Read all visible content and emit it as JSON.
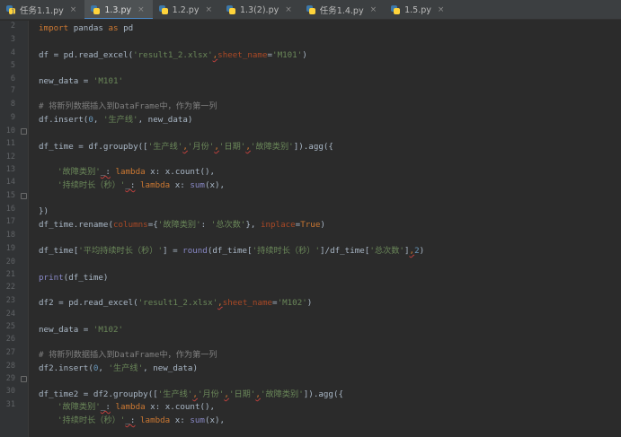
{
  "tabs": [
    {
      "label": "任务1.1.py",
      "active": false
    },
    {
      "label": "1.3.py",
      "active": true
    },
    {
      "label": "1.2.py",
      "active": false
    },
    {
      "label": "1.3(2).py",
      "active": false
    },
    {
      "label": "任务1.4.py",
      "active": false
    },
    {
      "label": "1.5.py",
      "active": false
    }
  ],
  "line_numbers": [
    "1",
    "2",
    "3",
    "4",
    "5",
    "6",
    "7",
    "8",
    "9",
    "10",
    "11",
    "12",
    "13",
    "14",
    "15",
    "16",
    "17",
    "18",
    "19",
    "20",
    "21",
    "22",
    "23",
    "24",
    "25",
    "26",
    "27",
    "28",
    "29",
    "30",
    "31"
  ],
  "code": {
    "l1_import": "import",
    "l1_mod": " pandas ",
    "l1_as": "as",
    "l1_alias": " pd",
    "l3_a": "df = pd.read_excel(",
    "l3_file": "'result1_2.xlsx'",
    "l3_comma": ",",
    "l3_kw": "sheet_name",
    "l3_eq": "=",
    "l3_sheet": "'M101'",
    "l3_close": ")",
    "l5_a": "new_data = ",
    "l5_val": "'M101'",
    "l7_cmt": "# 将新列数据插入到DataFrame中，作为第一列",
    "l8_a": "df.insert(",
    "l8_num": "0",
    "l8_b": ", ",
    "l8_str": "'生产线'",
    "l8_c": ", new_data)",
    "l10_a": "df_time = df.groupby([",
    "l10_s1": "'生产线'",
    "l10_c1": ",",
    "l10_s2": "'月份'",
    "l10_c2": ",",
    "l10_s3": "'日期'",
    "l10_c3": ",",
    "l10_s4": "'故障类别'",
    "l10_b": "]).agg({",
    "l12_str": "'故障类别'",
    "l12_colon": "_:",
    "l12_sp": " ",
    "l12_kw": "lambda",
    "l12_rest": " x: x.count(),",
    "l13_str": "'持续时长（秒）'",
    "l13_colon": "_:",
    "l13_sp": " ",
    "l13_kw": "lambda",
    "l13_mid": " x: ",
    "l13_fn": "sum",
    "l13_rest": "(x),",
    "l15": "})",
    "l16_a": "df_time.rename(",
    "l16_kw": "columns",
    "l16_b": "={",
    "l16_s1": "'故障类别'",
    "l16_c": ": ",
    "l16_s2": "'总次数'",
    "l16_d": "}, ",
    "l16_kw2": "inplace",
    "l16_e": "=",
    "l16_true": "True",
    "l16_f": ")",
    "l18_a": "df_time[",
    "l18_s1": "'平均持续时长（秒）'",
    "l18_b": "] = ",
    "l18_fn": "round",
    "l18_c": "(df_time[",
    "l18_s2": "'持续时长（秒）'",
    "l18_d": "]/df_time[",
    "l18_s3": "'总次数'",
    "l18_e": "]",
    "l18_comma": ",",
    "l18_num": "2",
    "l18_f": ")",
    "l20_fn": "print",
    "l20_rest": "(df_time)",
    "l22_a": "df2 = pd.read_excel(",
    "l22_file": "'result1_2.xlsx'",
    "l22_comma": ",",
    "l22_kw": "sheet_name",
    "l22_eq": "=",
    "l22_sheet": "'M102'",
    "l22_close": ")",
    "l24_a": "new_data = ",
    "l24_val": "'M102'",
    "l26_cmt": "# 将新列数据插入到DataFrame中，作为第一列",
    "l27_a": "df2.insert(",
    "l27_num": "0",
    "l27_b": ", ",
    "l27_str": "'生产线'",
    "l27_c": ", new_data)",
    "l29_a": "df_time2 = df2.groupby([",
    "l29_s1": "'生产线'",
    "l29_c1": ",",
    "l29_s2": "'月份'",
    "l29_c2": ",",
    "l29_s3": "'日期'",
    "l29_c3": ",",
    "l29_s4": "'故障类别'",
    "l29_b": "]).agg({",
    "l30_str": "'故障类别'",
    "l30_colon": "_:",
    "l30_sp": " ",
    "l30_kw": "lambda",
    "l30_rest": " x: x.count(),",
    "l31_str": "'持续时长（秒）'",
    "l31_colon": "_:",
    "l31_sp": " ",
    "l31_kw": "lambda",
    "l31_mid": " x: ",
    "l31_fn": "sum",
    "l31_rest": "(x),"
  },
  "colors": {
    "background": "#2b2b2b",
    "gutter": "#313335",
    "keyword": "#cc7832",
    "string": "#6a8759",
    "number": "#6897bb",
    "comment": "#808080",
    "kwarg": "#aa4926"
  }
}
